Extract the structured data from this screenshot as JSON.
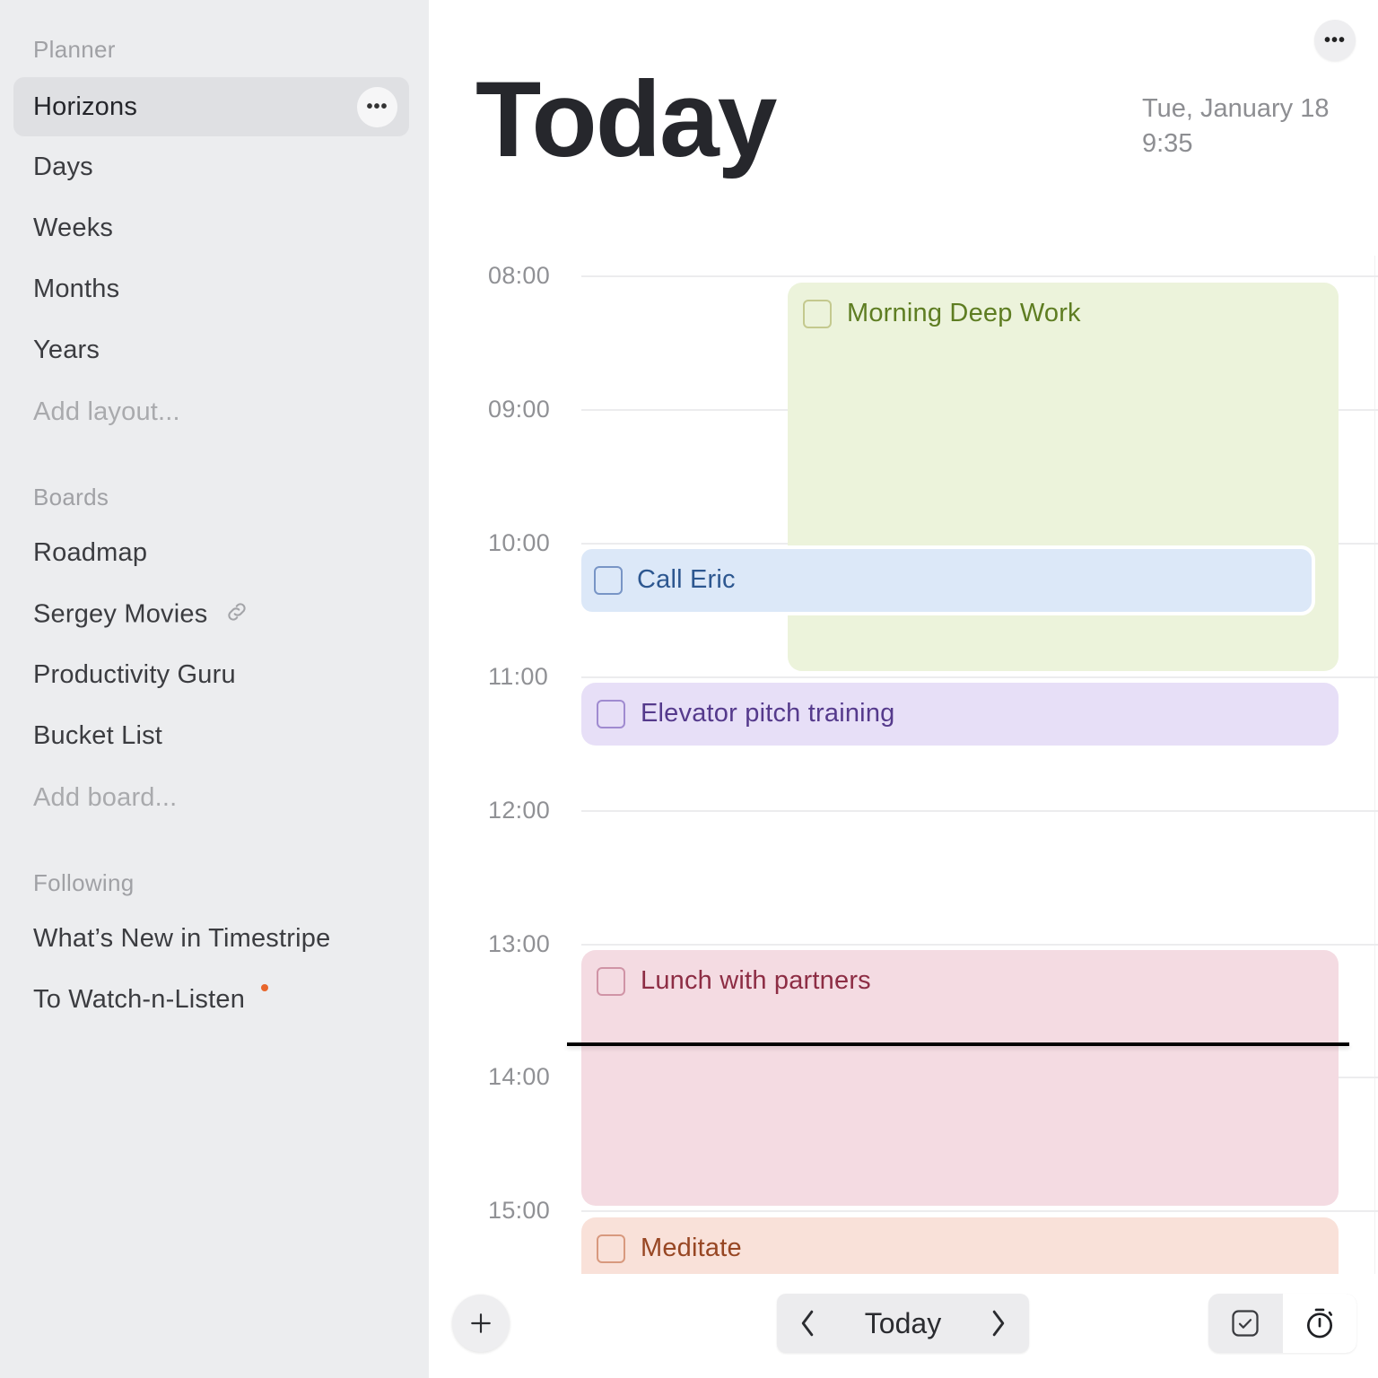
{
  "sidebar": {
    "sections": [
      {
        "header": "Planner",
        "items": [
          {
            "label": "Horizons",
            "selected": true
          },
          {
            "label": "Days"
          },
          {
            "label": "Weeks"
          },
          {
            "label": "Months"
          },
          {
            "label": "Years"
          }
        ],
        "add_label": "Add layout..."
      },
      {
        "header": "Boards",
        "items": [
          {
            "label": "Roadmap"
          },
          {
            "label": "Sergey Movies",
            "icon": "link-icon"
          },
          {
            "label": "Productivity Guru"
          },
          {
            "label": "Bucket List"
          }
        ],
        "add_label": "Add board..."
      },
      {
        "header": "Following",
        "items": [
          {
            "label": "What’s New in Timestripe"
          },
          {
            "label": "To Watch-n-Listen",
            "badge": "unread-dot"
          }
        ]
      }
    ],
    "more_icon": "more-horizontal-icon",
    "more_glyph": "•••"
  },
  "header": {
    "title": "Today",
    "date": "Tue, January 18",
    "time": "9:35",
    "more_glyph": "•••"
  },
  "timeline": {
    "hours": [
      "08:00",
      "09:00",
      "10:00",
      "11:00",
      "12:00",
      "13:00",
      "14:00",
      "15:00"
    ],
    "current_time": "13:44",
    "events": [
      {
        "title": "Morning Deep Work",
        "start": "08:00",
        "end": "11:00",
        "color": "#ecf3db",
        "text_color": "#5e7d22",
        "done": false
      },
      {
        "title": "Call Eric",
        "start": "10:00",
        "end": "10:30",
        "color": "#dce8f8",
        "text_color": "#2d5790",
        "done": false
      },
      {
        "title": "Elevator pitch training",
        "start": "11:00",
        "end": "11:30",
        "color": "#e7dff7",
        "text_color": "#553a8c",
        "done": false
      },
      {
        "title": "Lunch with partners",
        "start": "13:00",
        "end": "15:00",
        "color": "#f4dbe2",
        "text_color": "#8d2d44",
        "done": false
      },
      {
        "title": "Meditate",
        "start": "15:00",
        "end": "",
        "color": "#f9e1d9",
        "text_color": "#974623",
        "done": false
      }
    ]
  },
  "bottom_bar": {
    "add_icon": "plus-icon",
    "prev_icon": "chevron-left-icon",
    "today_label": "Today",
    "next_icon": "chevron-right-icon",
    "modes": [
      {
        "name": "tasks",
        "icon": "checkbox-icon",
        "active": false
      },
      {
        "name": "timer",
        "icon": "stopwatch-icon",
        "active": true
      }
    ]
  }
}
